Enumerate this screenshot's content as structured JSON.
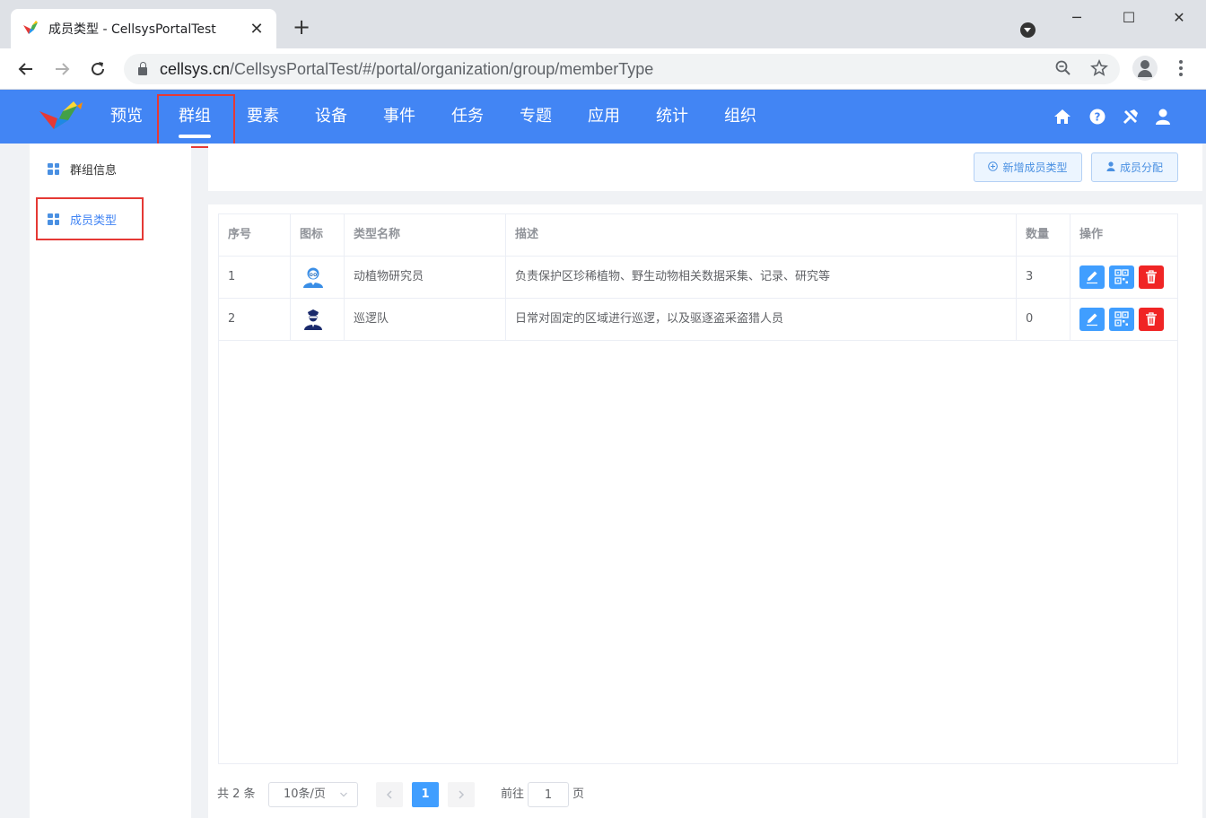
{
  "browser": {
    "tab_title": "成员类型 - CellsysPortalTest",
    "tab_close": "✕",
    "new_tab": "+",
    "url_host": "cellsys.cn",
    "url_path": "/CellsysPortalTest/#/portal/organization/group/memberType",
    "window_minimize": "─",
    "window_maximize": "☐",
    "window_close": "✕"
  },
  "header": {
    "nav": [
      "预览",
      "群组",
      "要素",
      "设备",
      "事件",
      "任务",
      "专题",
      "应用",
      "统计",
      "组织"
    ],
    "active": "群组",
    "icons": [
      "home-icon",
      "help-icon",
      "tools-icon",
      "user-icon"
    ]
  },
  "sidebar": {
    "items": [
      {
        "label": "群组信息",
        "icon": "grid-icon"
      },
      {
        "label": "成员类型",
        "icon": "grid-icon",
        "active": true
      }
    ]
  },
  "toolbar": {
    "add_label": "新增成员类型",
    "assign_label": "成员分配"
  },
  "table": {
    "columns": [
      "序号",
      "图标",
      "类型名称",
      "描述",
      "数量",
      "操作"
    ],
    "rows": [
      {
        "index": "1",
        "icon": "researcher-icon",
        "name": "动植物研究员",
        "desc": "负责保护区珍稀植物、野生动物相关数据采集、记录、研究等",
        "count": "3"
      },
      {
        "index": "2",
        "icon": "patrol-icon",
        "name": "巡逻队",
        "desc": "日常对固定的区域进行巡逻，以及驱逐盗采盗猎人员",
        "count": "0"
      }
    ]
  },
  "pagination": {
    "total": "共 2 条",
    "page_size": "10条/页",
    "current_page": "1",
    "goto_label": "前往",
    "goto_value": "1",
    "page_unit": "页"
  },
  "colors": {
    "header_bg": "#4285f4",
    "accent": "#409eff",
    "danger": "#f02525",
    "highlight_box": "#e53935"
  }
}
